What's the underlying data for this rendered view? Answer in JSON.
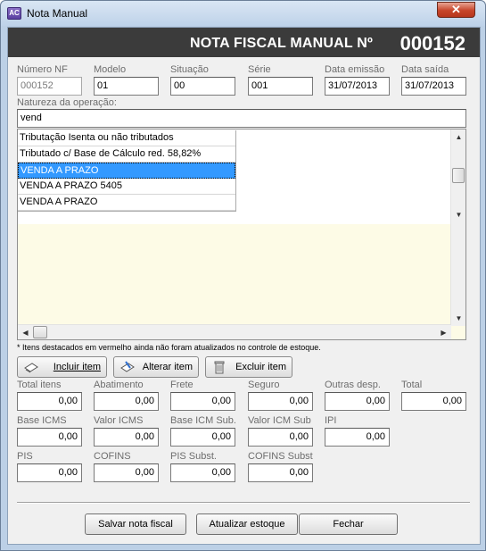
{
  "window": {
    "title": "Nota Manual",
    "icon_text": "AC",
    "close_glyph": "✕"
  },
  "header": {
    "title": "NOTA FISCAL MANUAL Nº",
    "number": "000152"
  },
  "fields": {
    "numero_nf": {
      "label": "Número NF",
      "value": "000152"
    },
    "modelo": {
      "label": "Modelo",
      "value": "01"
    },
    "situacao": {
      "label": "Situação",
      "value": "00"
    },
    "serie": {
      "label": "Série",
      "value": "001"
    },
    "data_emissao": {
      "label": "Data emissão",
      "value": "31/07/2013"
    },
    "data_saida": {
      "label": "Data saída",
      "value": "31/07/2013"
    },
    "natureza": {
      "label": "Natureza da operação:",
      "value": "vend"
    }
  },
  "autocomplete": {
    "items": [
      "Tributação Isenta ou não tributados",
      "Tributado c/ Base de Cálculo red. 58,82%",
      "VENDA  A  PRAZO",
      "VENDA  A  PRAZO  5405",
      "VENDA  A PRAZO"
    ],
    "selected_index": 2
  },
  "note": "* Itens destacados em vermelho ainda não foram atualizados no controle de estoque.",
  "item_buttons": {
    "incluir": "Incluir item",
    "alterar": "Alterar item",
    "excluir": "Excluir item"
  },
  "totals": {
    "total_itens": {
      "label": "Total itens",
      "value": "0,00"
    },
    "abatimento": {
      "label": "Abatimento",
      "value": "0,00"
    },
    "frete": {
      "label": "Frete",
      "value": "0,00"
    },
    "seguro": {
      "label": "Seguro",
      "value": "0,00"
    },
    "outras": {
      "label": "Outras desp.",
      "value": "0,00"
    },
    "total": {
      "label": "Total",
      "value": "0,00"
    },
    "base_icms": {
      "label": "Base ICMS",
      "value": "0,00"
    },
    "valor_icms": {
      "label": "Valor ICMS",
      "value": "0,00"
    },
    "base_icm_sub": {
      "label": "Base ICM Sub.",
      "value": "0,00"
    },
    "valor_icm_sub": {
      "label": "Valor ICM Sub",
      "value": "0,00"
    },
    "ipi": {
      "label": "IPI",
      "value": "0,00"
    },
    "pis": {
      "label": "PIS",
      "value": "0,00"
    },
    "cofins": {
      "label": "COFINS",
      "value": "0,00"
    },
    "pis_subst": {
      "label": "PIS Subst.",
      "value": "0,00"
    },
    "cofins_subst": {
      "label": "COFINS Subst",
      "value": "0,00"
    }
  },
  "footer_buttons": {
    "salvar": "Salvar nota fiscal",
    "atualizar": "Atualizar estoque",
    "fechar": "Fechar"
  },
  "colors": {
    "header_bg": "#3b3b3b",
    "selection": "#3399ff",
    "list_bg": "#fdfbe6"
  }
}
